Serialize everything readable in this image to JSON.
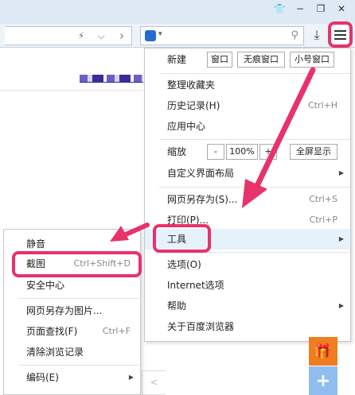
{
  "window_controls": [
    "👕",
    "−",
    "❐",
    "✕"
  ],
  "toolbar": {
    "flash": "⚡",
    "dropdown": "⌵",
    "forward": "›",
    "search_engine": "🐾",
    "search_caret": "▾",
    "search_icon": "⚲",
    "download_icon": "⤓"
  },
  "main_menu": {
    "new_label": "新建",
    "new_window": "窗口",
    "new_incognito": "无痕窗口",
    "new_small": "小号窗口",
    "bookmarks": "整理收藏夹",
    "history": {
      "label": "历史记录(H)",
      "shortcut": "Ctrl+H"
    },
    "app_center": "应用中心",
    "zoom_label": "缩放",
    "zoom_minus": "-",
    "zoom_value": "100%",
    "zoom_plus": "+",
    "fullscreen": "全屏显示",
    "customize": "自定义界面布局",
    "save_as": {
      "label": "网页另存为(S)...",
      "shortcut": "Ctrl+S"
    },
    "print": {
      "label": "打印(P)...",
      "shortcut": "Ctrl+P"
    },
    "tools": "工具",
    "options": "选项(O)",
    "internet_options": "Internet选项",
    "help": "帮助",
    "about": "关于百度浏览器"
  },
  "sub_menu": {
    "mute": "静音",
    "screenshot": {
      "label": "截图",
      "shortcut": "Ctrl+Shift+D"
    },
    "security": "安全中心",
    "save_image": "网页另存为图片...",
    "find": {
      "label": "页面查找(F)",
      "shortcut": "Ctrl+F"
    },
    "clear_history": "清除浏览记录",
    "encoding": "编码(E)"
  },
  "side_buttons": {
    "gift": "🎁",
    "add": "+"
  },
  "scroll_fragment": "<",
  "colors": {
    "highlight": "#e8326a",
    "gift_bg": "#f07d1f",
    "add_bg": "#8fbdf0"
  }
}
